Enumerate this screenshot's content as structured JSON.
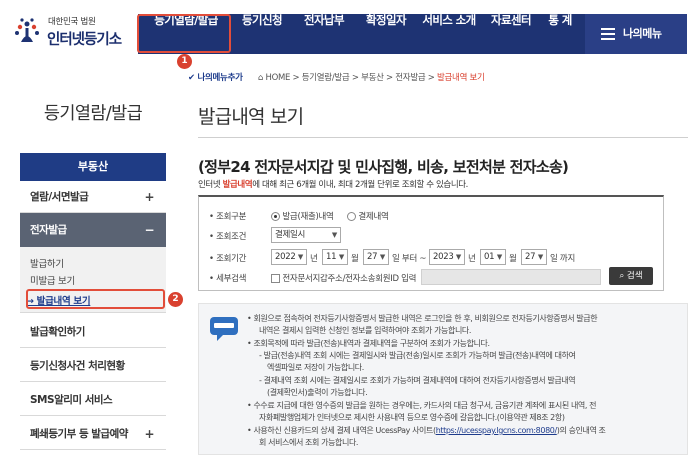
{
  "header": {
    "logo_line1": "대한민국 법원",
    "logo_line2": "인터넷등기소",
    "nav": [
      {
        "label": "등기열람/발급"
      },
      {
        "label": "등기신청"
      },
      {
        "label": "전자납부"
      },
      {
        "label": "확정일자"
      },
      {
        "label": "서비스 소개"
      },
      {
        "label": "자료센터"
      },
      {
        "label": "통 계"
      }
    ],
    "menu_label": "나의메뉴"
  },
  "badges": [
    "1",
    "2"
  ],
  "sidebar": {
    "title": "등기열람/발급",
    "section": "부동산",
    "items": [
      {
        "label": "열람/서면발급",
        "toggle": "+"
      },
      {
        "label": "전자발급",
        "toggle": "−"
      },
      {
        "label": "발급확인하기"
      },
      {
        "label": "등기신청사건 처리현황"
      },
      {
        "label": "SMS알리미 서비스"
      },
      {
        "label": "폐쇄등기부 등 발급예약",
        "toggle": "+"
      }
    ],
    "subitems": [
      {
        "label": "발급하기"
      },
      {
        "label": "미발급 보기"
      },
      {
        "label": "→ 발급내역 보기"
      }
    ]
  },
  "breadcrumb": {
    "tab": "나의메뉴추가",
    "home": "HOME",
    "parts": [
      "등기열람/발급",
      "부동산",
      "전자발급"
    ],
    "current": "발급내역 보기",
    "sep": " > "
  },
  "main": {
    "title": "발급내역 보기",
    "headline": "(정부24 전자문서지갑 및 민사집행, 비송, 보전처분 전자소송)",
    "subnote_a": "인터넷 ",
    "subnote_b": "발급내역",
    "subnote_c": "에 대해 최근 6개월 이내, 최대 2개월 단위로 조회할 수 있습니다."
  },
  "search": {
    "row1_label": "• 조회구분",
    "opt1": "발급(재출)내역",
    "opt2": "결제내역",
    "row2_label": "• 조회조건",
    "cond_value": "결제일시",
    "row3_label": "• 조회기간",
    "from_year": "2022",
    "from_month": "11",
    "from_day": "27",
    "to_year": "2023",
    "to_month": "01",
    "to_day": "27",
    "unit_year": "년",
    "unit_month": "월",
    "unit_from": "일 부터 ~",
    "unit_to": "일 까지",
    "row4_label": "• 세부검색",
    "detail_label": "전자문서지갑주소/전자소송회원ID 입력",
    "search_button": "검색"
  },
  "notices": [
    "• 회원으로 접속하여 전자등기사항증명서 발급한 내역은 로그인을 한 후, 비회원으로 전자등기사항증명서 발급한",
    "내역은 결제시 입력한 신청인 정보를 입력하여야 조회가 가능합니다.",
    "• 조회목적에 따라 발급(전송)내역과 결제내역을 구분하여 조회가 가능합니다.",
    "- 발급(전송)내역 조회 시에는 결제일시와 발급(전송)일시로 조회가 가능하며 발급(전송)내역에 대하여",
    "엑셀파일로 저장이 가능합니다.",
    "- 결제내역 조회 시에는 결제일시로 조회가 가능하며 결제내역에 대하여 전자등기사항증명서 발급내역",
    "(결제확인서)출력이 가능합니다.",
    "• 수수료 지급에 대한 영수증의 발급을 원하는 경우에는, 카드사의 대금 청구서, 금융기관 계좌에 표시된 내역, 전",
    "자화폐발행업체가 인터넷으로 제시한 사용내역 등으로 영수증에 갈음합니다.(이용약관 제8조 2항)",
    "• 사용하신 신용카드의 상세 결제 내역은 UcessPay 사이트(",
    "https://ucesspay.lgcns.com:8080/",
    ")의 승인내역 조",
    "회 서비스에서 조회 가능합니다."
  ]
}
